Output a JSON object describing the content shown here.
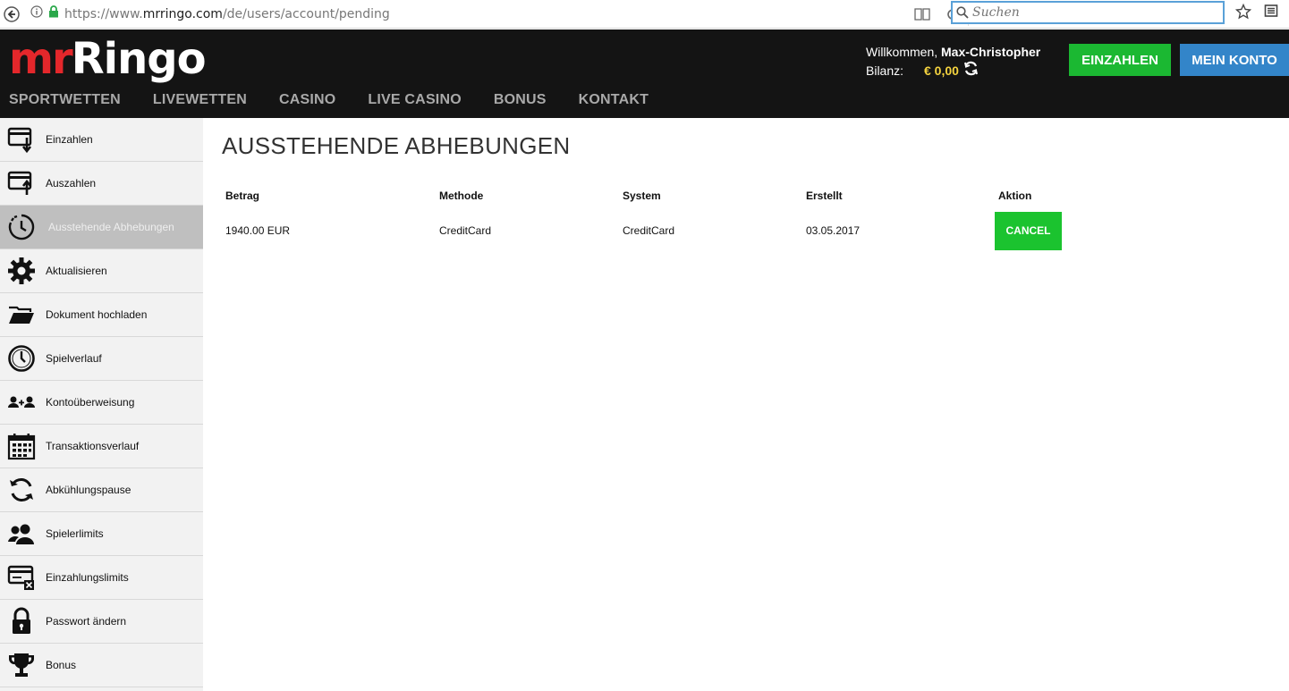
{
  "browser": {
    "url_prefix": "https://www.",
    "url_domain": "mrringo.com",
    "url_path": "/de/users/account/pending",
    "search_placeholder": "Suchen"
  },
  "header": {
    "logo_mr": "mr",
    "logo_ringo": "Ringo",
    "welcome_prefix": "Willkommen,",
    "user_name": "Max-Christopher",
    "balance_label": "Bilanz:",
    "balance_value": "€ 0,00",
    "deposit_label": "EINZAHLEN",
    "account_label": "MEIN KONTO",
    "nav": [
      "SPORTWETTEN",
      "LIVEWETTEN",
      "CASINO",
      "LIVE CASINO",
      "BONUS",
      "KONTAKT"
    ]
  },
  "sidebar": {
    "items": [
      {
        "label": "Einzahlen",
        "icon": "deposit-icon"
      },
      {
        "label": "Auszahlen",
        "icon": "withdraw-icon"
      },
      {
        "label": "Ausstehende Abhebungen",
        "icon": "clock-dashed-icon",
        "active": true
      },
      {
        "label": "Aktualisieren",
        "icon": "gear-icon"
      },
      {
        "label": "Dokument hochladen",
        "icon": "folder-icon"
      },
      {
        "label": "Spielverlauf",
        "icon": "clock-icon"
      },
      {
        "label": "Kontoüberweisung",
        "icon": "transfer-users-icon"
      },
      {
        "label": "Transaktionsverlauf",
        "icon": "calendar-icon"
      },
      {
        "label": "Abkühlungspause",
        "icon": "refresh-icon"
      },
      {
        "label": "Spielerlimits",
        "icon": "users-icon"
      },
      {
        "label": "Einzahlungslimits",
        "icon": "card-limit-icon"
      },
      {
        "label": "Passwort ändern",
        "icon": "lock-icon"
      },
      {
        "label": "Bonus",
        "icon": "trophy-icon"
      }
    ]
  },
  "main": {
    "title": "AUSSTEHENDE ABHEBUNGEN",
    "columns": [
      "Betrag",
      "Methode",
      "System",
      "Erstellt",
      "Aktion"
    ],
    "rows": [
      {
        "amount": "1940.00 EUR",
        "method": "CreditCard",
        "system": "CreditCard",
        "created": "03.05.2017",
        "action": "CANCEL"
      }
    ]
  }
}
